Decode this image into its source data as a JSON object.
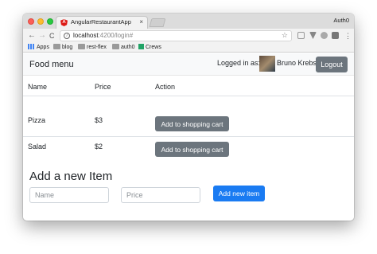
{
  "browser": {
    "tab_title": "AngularRestaurantApp",
    "tab_favicon_letter": "A",
    "tab_close": "×",
    "profile_label": "Auth0",
    "nav": {
      "back": "←",
      "forward": "→",
      "reload": "C"
    },
    "url_host": "localhost",
    "url_rest": ":4200/login#",
    "star_icon": "☆",
    "bookmarks": [
      {
        "label": "Apps",
        "icon": "apps-icon"
      },
      {
        "label": "blog",
        "icon": "folder-icon"
      },
      {
        "label": "rest-flex",
        "icon": "folder-icon"
      },
      {
        "label": "auth0",
        "icon": "folder-icon"
      },
      {
        "label": "Crews",
        "icon": "crews-icon"
      }
    ]
  },
  "navbar": {
    "brand": "Food menu",
    "logged_in_label": "Logged in as:",
    "user_name": "Bruno Krebs",
    "logout_label": "Logout"
  },
  "table": {
    "headers": [
      "Name",
      "Price",
      "Action"
    ],
    "rows": [
      {
        "name": "Pizza",
        "price": "$3",
        "action": "Add to shopping cart"
      },
      {
        "name": "Salad",
        "price": "$2",
        "action": "Add to shopping cart"
      }
    ]
  },
  "form": {
    "title": "Add a new Item",
    "name_placeholder": "Name",
    "price_placeholder": "Price",
    "submit_label": "Add new item"
  },
  "colors": {
    "primary": "#1a7bf2",
    "secondary": "#6c757d",
    "navbar_bg": "#f8f9fa"
  }
}
